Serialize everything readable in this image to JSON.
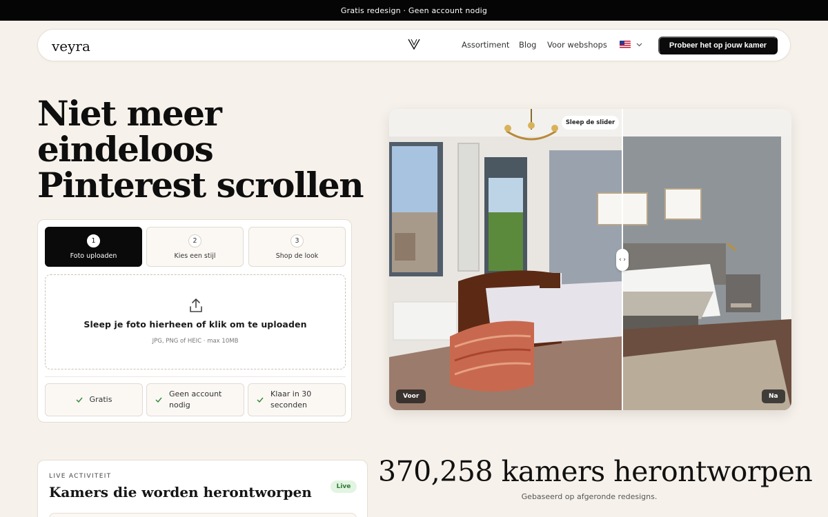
{
  "announcement": "Gratis redesign · Geen account nodig",
  "nav": {
    "brand": "veyra",
    "links": [
      "Assortiment",
      "Blog",
      "Voor webshops"
    ],
    "cta": "Probeer het op jouw kamer"
  },
  "hero": {
    "title_lines": [
      "Niet meer",
      "eindeloos",
      "Pinterest scrollen"
    ]
  },
  "steps": [
    {
      "number": "1",
      "label": "Foto uploaden",
      "active": true
    },
    {
      "number": "2",
      "label": "Kies een stijl",
      "active": false
    },
    {
      "number": "3",
      "label": "Shop de look",
      "active": false
    }
  ],
  "upload": {
    "main": "Sleep je foto hierheen of klik om te uploaden",
    "sub": "JPG, PNG of HEIC · max 10MB"
  },
  "features": [
    {
      "line1": "Gratis",
      "line2": ""
    },
    {
      "line1": "Geen account",
      "line2": "nodig"
    },
    {
      "line1": "Klaar in 30",
      "line2": "seconden"
    }
  ],
  "compare": {
    "tooltip": "Sleep de slider",
    "handle": "‹ ›",
    "before": "Voor",
    "after": "Na",
    "position": 0.58
  },
  "live": {
    "eyebrow": "LIVE ACTIVITEIT",
    "title": "Kamers die worden herontworpen",
    "badge": "Live"
  },
  "stats": {
    "headline": "370,258 kamers herontworpen",
    "sub": "Gebaseerd op afgeronde redesigns."
  },
  "icons": {
    "logo": "v-logo-icon",
    "flag": "us-flag-icon",
    "chevron": "chevron-down-icon",
    "upload": "upload-icon",
    "check": "check-icon"
  },
  "colors": {
    "background": "#f6f1ea",
    "accent": "#0a0a0a",
    "check": "#3a8a3e",
    "live": "#2d7a32"
  }
}
